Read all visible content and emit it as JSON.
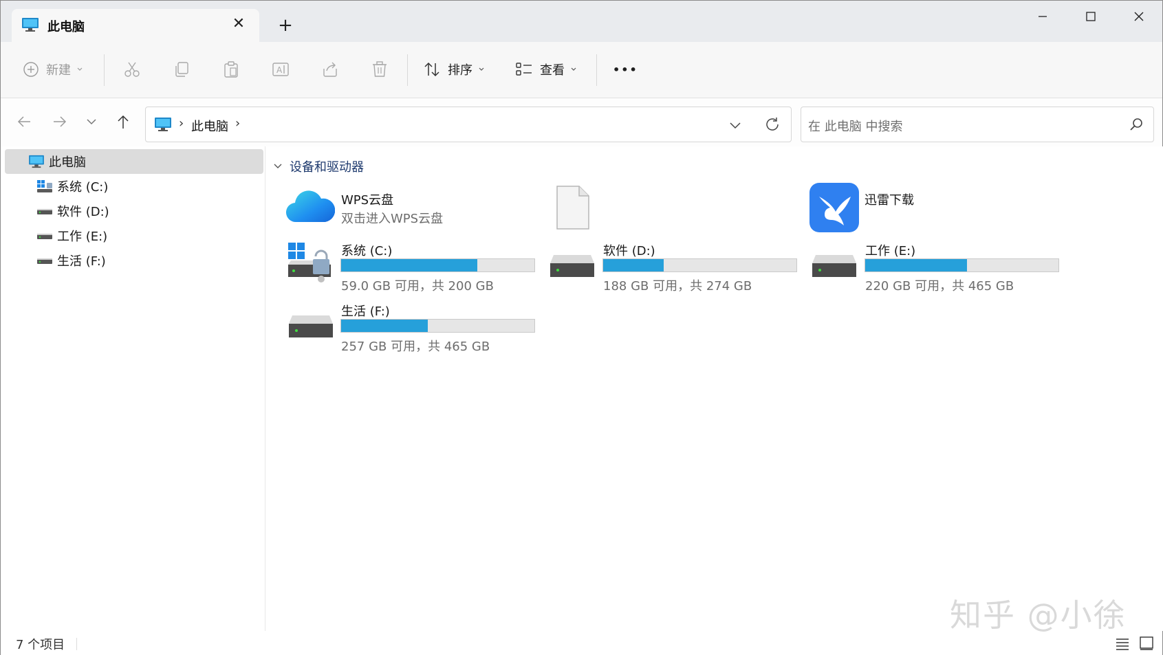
{
  "tab": {
    "title": "此电脑",
    "close": "✕",
    "new_tab": "+"
  },
  "commands": {
    "new_label": "新建",
    "sort_label": "排序",
    "view_label": "查看",
    "more": "•••"
  },
  "address": {
    "crumb": "此电脑",
    "chevron": "›"
  },
  "search": {
    "placeholder": "在 此电脑 中搜索"
  },
  "sidebar": {
    "items": [
      {
        "label": "此电脑"
      },
      {
        "label": "系统 (C:)"
      },
      {
        "label": "软件 (D:)"
      },
      {
        "label": "工作 (E:)"
      },
      {
        "label": "生活 (F:)"
      }
    ]
  },
  "main": {
    "group_title": "设备和驱动器",
    "apps": [
      {
        "name": "WPS云盘",
        "sub": "双击进入WPS云盘",
        "icon": "cloud-icon"
      },
      {
        "name": "",
        "sub": "",
        "icon": "blank-file-icon"
      },
      {
        "name": "迅雷下载",
        "sub": "",
        "icon": "thunder-bird-icon"
      }
    ],
    "drives": [
      {
        "name": "系统 (C:)",
        "free": "59.0 GB 可用，共 200 GB",
        "used_fraction": 0.705,
        "icon": "system-drive-icon"
      },
      {
        "name": "软件 (D:)",
        "free": "188 GB 可用，共 274 GB",
        "used_fraction": 0.314,
        "icon": "hard-drive-icon"
      },
      {
        "name": "工作 (E:)",
        "free": "220 GB 可用，共 465 GB",
        "used_fraction": 0.527,
        "icon": "hard-drive-icon"
      },
      {
        "name": "生活 (F:)",
        "free": "257 GB 可用，共 465 GB",
        "used_fraction": 0.447,
        "icon": "hard-drive-icon"
      }
    ]
  },
  "status": {
    "count": "7 个项目"
  },
  "watermark": "知乎 @小徐",
  "colors": {
    "accent": "#26a0da",
    "selection": "#dcdcdc",
    "group_title": "#1e3a6e"
  }
}
